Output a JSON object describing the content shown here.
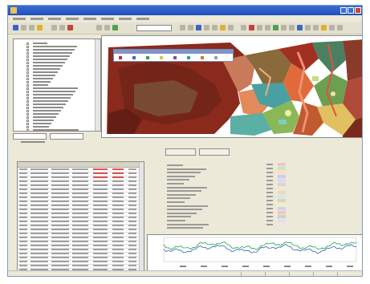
{
  "window": {
    "title_bar": "",
    "state": "maximized"
  },
  "menu": {
    "items": [
      "",
      "",
      "",
      "",
      "",
      "",
      "",
      ""
    ]
  },
  "toolbar": {
    "icons": [
      "open-icon",
      "save-icon",
      "print-icon",
      "zoom-in-icon",
      "zoom-out-icon",
      "pan-icon",
      "select-icon",
      "identify-icon",
      "layer-icon",
      "settings-icon"
    ],
    "accent_colors": [
      "#3c64c8",
      "#50a050",
      "#c84040",
      "#e0b030"
    ]
  },
  "layer_tree": {
    "rows": 28
  },
  "map": {
    "legend_swatch_colors": [
      "#c03020",
      "#3070c0",
      "#40a040",
      "#e0c040",
      "#8050a0",
      "#30a0a0",
      "#e07030",
      "#a0a0a0"
    ]
  },
  "table": {
    "columns": 7,
    "rows": 26,
    "highlight_color": "#e05050"
  },
  "attribute_list": {
    "rows": 18
  },
  "classes": {
    "colors": [
      "#f4c6c6",
      "#c6e6c6",
      "#f8e2b8",
      "#d6c6f0",
      "#c6e2f4",
      "#f0c6e0",
      "#e6f0c6",
      "#f4d2c6",
      "#c6f0e6",
      "#e0d0c0",
      "#f0f0c0",
      "#d0d0f0",
      "#f6c0c0",
      "#c0d8c0",
      "#f0d8f0",
      "#e8e8e8"
    ]
  },
  "profile_chart": {
    "series": [
      {
        "color": "#20a040"
      },
      {
        "color": "#3060c0"
      }
    ]
  }
}
